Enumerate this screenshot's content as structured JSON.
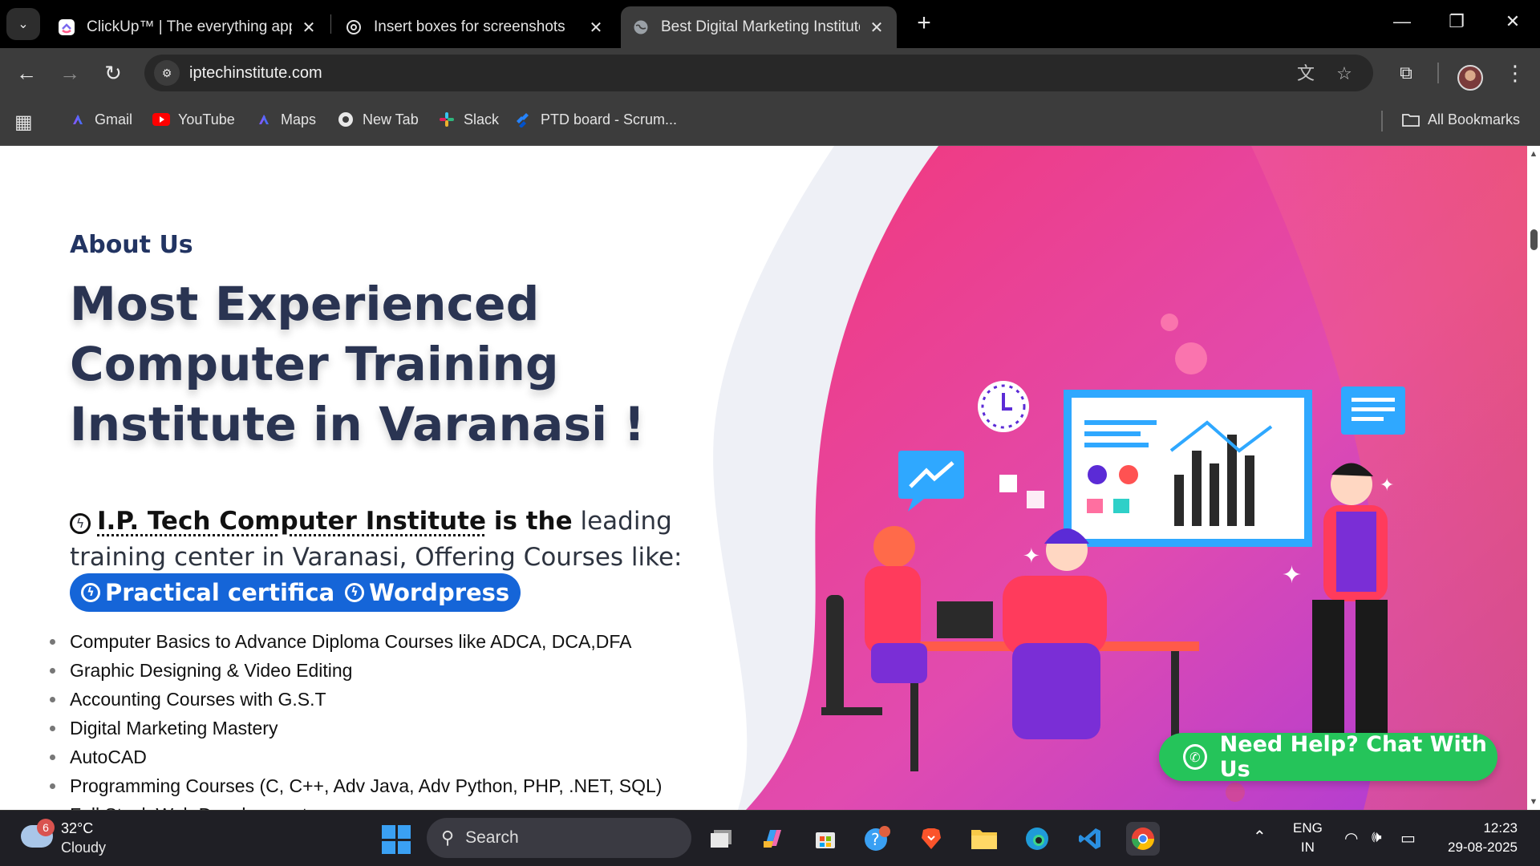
{
  "browser": {
    "tabs": [
      {
        "title": "ClickUp™ | The everything app f",
        "icon": "clickup-icon",
        "active": false
      },
      {
        "title": "Insert boxes for screenshots",
        "icon": "chatgpt-icon",
        "active": false
      },
      {
        "title": "Best Digital Marketing Institute",
        "icon": "globe-icon",
        "active": true
      }
    ],
    "url": "iptechinstitute.com",
    "bookmarks": [
      {
        "label": "Gmail",
        "icon": "gmail-icon"
      },
      {
        "label": "YouTube",
        "icon": "youtube-icon"
      },
      {
        "label": "Maps",
        "icon": "maps-icon"
      },
      {
        "label": "New Tab",
        "icon": "chrome-icon"
      },
      {
        "label": "Slack",
        "icon": "slack-icon"
      },
      {
        "label": "PTD board - Scrum...",
        "icon": "jira-icon"
      }
    ],
    "all_bookmarks": "All Bookmarks"
  },
  "page": {
    "about_label": "About Us",
    "headline": "Most Experienced Computer Training Institute in Varanasi !",
    "intro_brand": "I.P. Tech Computer Institute",
    "intro_bold": "is the",
    "intro_rest": "leading training center in Varanasi, Offering Courses like:",
    "pills": [
      "Practical certificate",
      "Wordpress"
    ],
    "courses": [
      "Computer Basics to Advance Diploma Courses like ADCA, DCA,DFA",
      "Graphic Designing & Video Editing",
      "Accounting Courses with G.S.T",
      "Digital Marketing Mastery",
      "AutoCAD",
      "Programming Courses (C, C++, Adv Java, Adv Python, PHP, .NET, SQL)",
      "Full Stack Web Development"
    ],
    "chat_button": "Need Help? Chat With Us",
    "colors": {
      "accent_blue": "#1565d8",
      "heading": "#2a3452",
      "whatsapp_green": "#25c45a",
      "hero_pink": "#f0527a",
      "hero_purple": "#b43bd6"
    }
  },
  "taskbar": {
    "weather_badge": "6",
    "temperature": "32°C",
    "condition": "Cloudy",
    "search_placeholder": "Search",
    "language_top": "ENG",
    "language_bottom": "IN",
    "time": "12:23",
    "date": "29-08-2025"
  }
}
